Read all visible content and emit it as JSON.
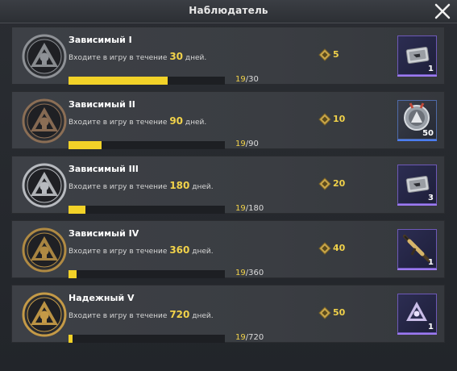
{
  "window": {
    "title": "Наблюдатель"
  },
  "rows": [
    {
      "name": "Зависимый I",
      "desc_pre": "Входите в игру в течение",
      "days": "30",
      "desc_post": "дней.",
      "progress_current": "19",
      "progress_total": "/30",
      "progress_fraction": 0.633,
      "coins": "5",
      "reward_qty": "1",
      "reward_icon": "voucher-icon",
      "badge_color": "#8e9196"
    },
    {
      "name": "Зависимый II",
      "desc_pre": "Входите в игру в течение",
      "days": "90",
      "desc_post": "дней.",
      "progress_current": "19",
      "progress_total": "/90",
      "progress_fraction": 0.211,
      "coins": "10",
      "reward_qty": "50",
      "reward_icon": "medal-coin-icon",
      "badge_color": "#8b6e55"
    },
    {
      "name": "Зависимый III",
      "desc_pre": "Входите в игру в течение",
      "days": "180",
      "desc_post": "дней.",
      "progress_current": "19",
      "progress_total": "/180",
      "progress_fraction": 0.106,
      "coins": "20",
      "reward_qty": "3",
      "reward_icon": "voucher-icon",
      "badge_color": "#b7babf"
    },
    {
      "name": "Зависимый IV",
      "desc_pre": "Входите в игру в течение",
      "days": "360",
      "desc_post": "дней.",
      "progress_current": "19",
      "progress_total": "/360",
      "progress_fraction": 0.053,
      "coins": "40",
      "reward_qty": "1",
      "reward_icon": "rifle-icon",
      "badge_color": "#b08a43"
    },
    {
      "name": "Надежный V",
      "desc_pre": "Входите в игру в течение",
      "days": "720",
      "desc_post": "дней.",
      "progress_current": "19",
      "progress_total": "/720",
      "progress_fraction": 0.026,
      "coins": "50",
      "reward_qty": "1",
      "reward_icon": "title-emblem-icon",
      "badge_color": "#c49a47"
    }
  ],
  "colors": {
    "accent": "#f2d228",
    "rare_border": "#6e59b8",
    "blue_border": "#4f6aa8"
  }
}
